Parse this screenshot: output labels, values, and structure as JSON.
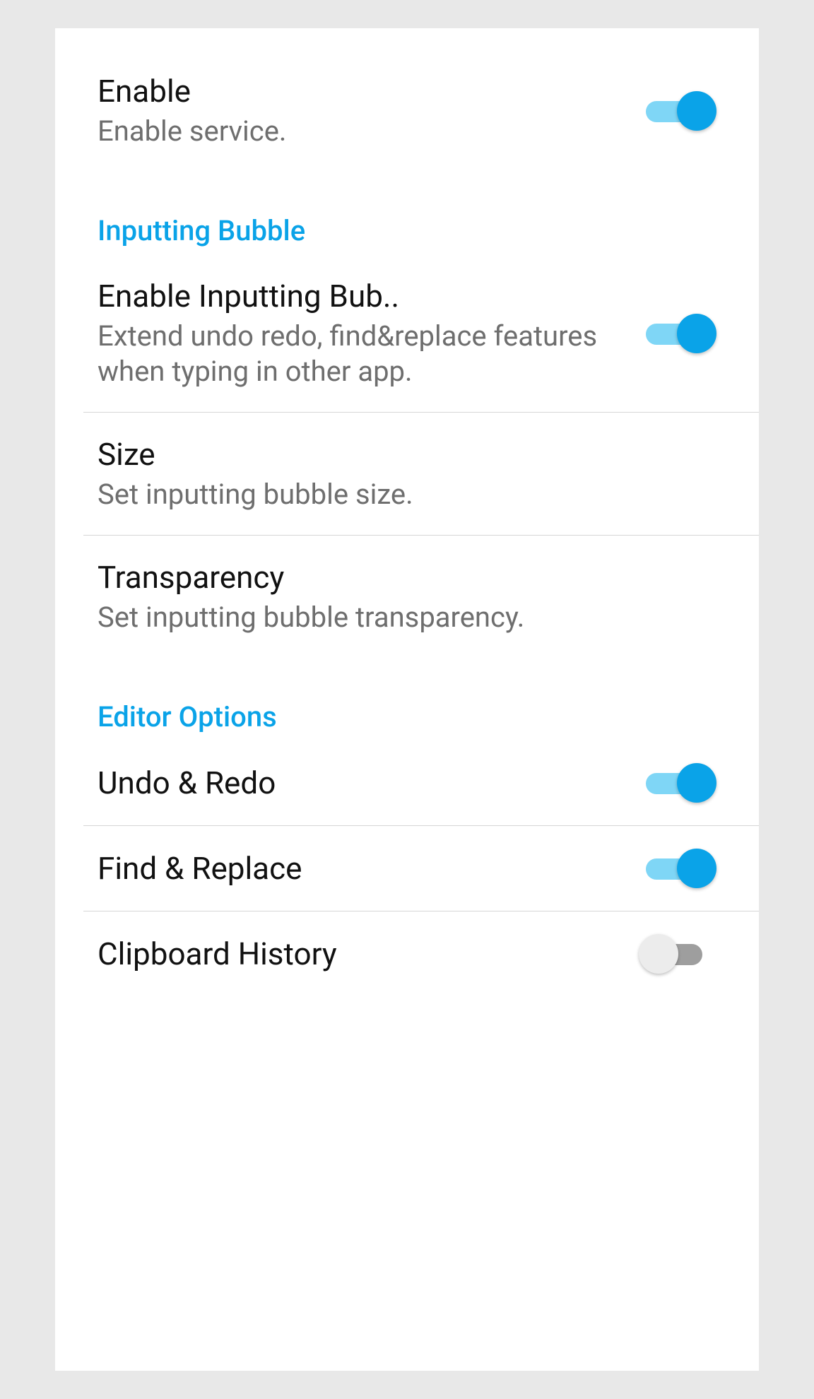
{
  "colors": {
    "accent": "#0aa3e8",
    "accent_light": "#7fd6f6",
    "off_track": "#9e9e9e",
    "off_thumb": "#ececec"
  },
  "rows": {
    "enable": {
      "title": "Enable",
      "subtitle": "Enable service.",
      "on": true
    }
  },
  "sections": {
    "inputting_bubble": {
      "header": "Inputting Bubble",
      "enable": {
        "title": "Enable Inputting Bub..",
        "subtitle": "Extend undo redo, find&replace features when typing in other app.",
        "on": true
      },
      "size": {
        "title": "Size",
        "subtitle": "Set inputting bubble size."
      },
      "transparency": {
        "title": "Transparency",
        "subtitle": "Set inputting bubble transparency."
      }
    },
    "editor_options": {
      "header": "Editor Options",
      "undo_redo": {
        "title": "Undo & Redo",
        "on": true
      },
      "find_replace": {
        "title": "Find & Replace",
        "on": true
      },
      "clipboard_history": {
        "title": "Clipboard History",
        "on": false
      }
    }
  }
}
